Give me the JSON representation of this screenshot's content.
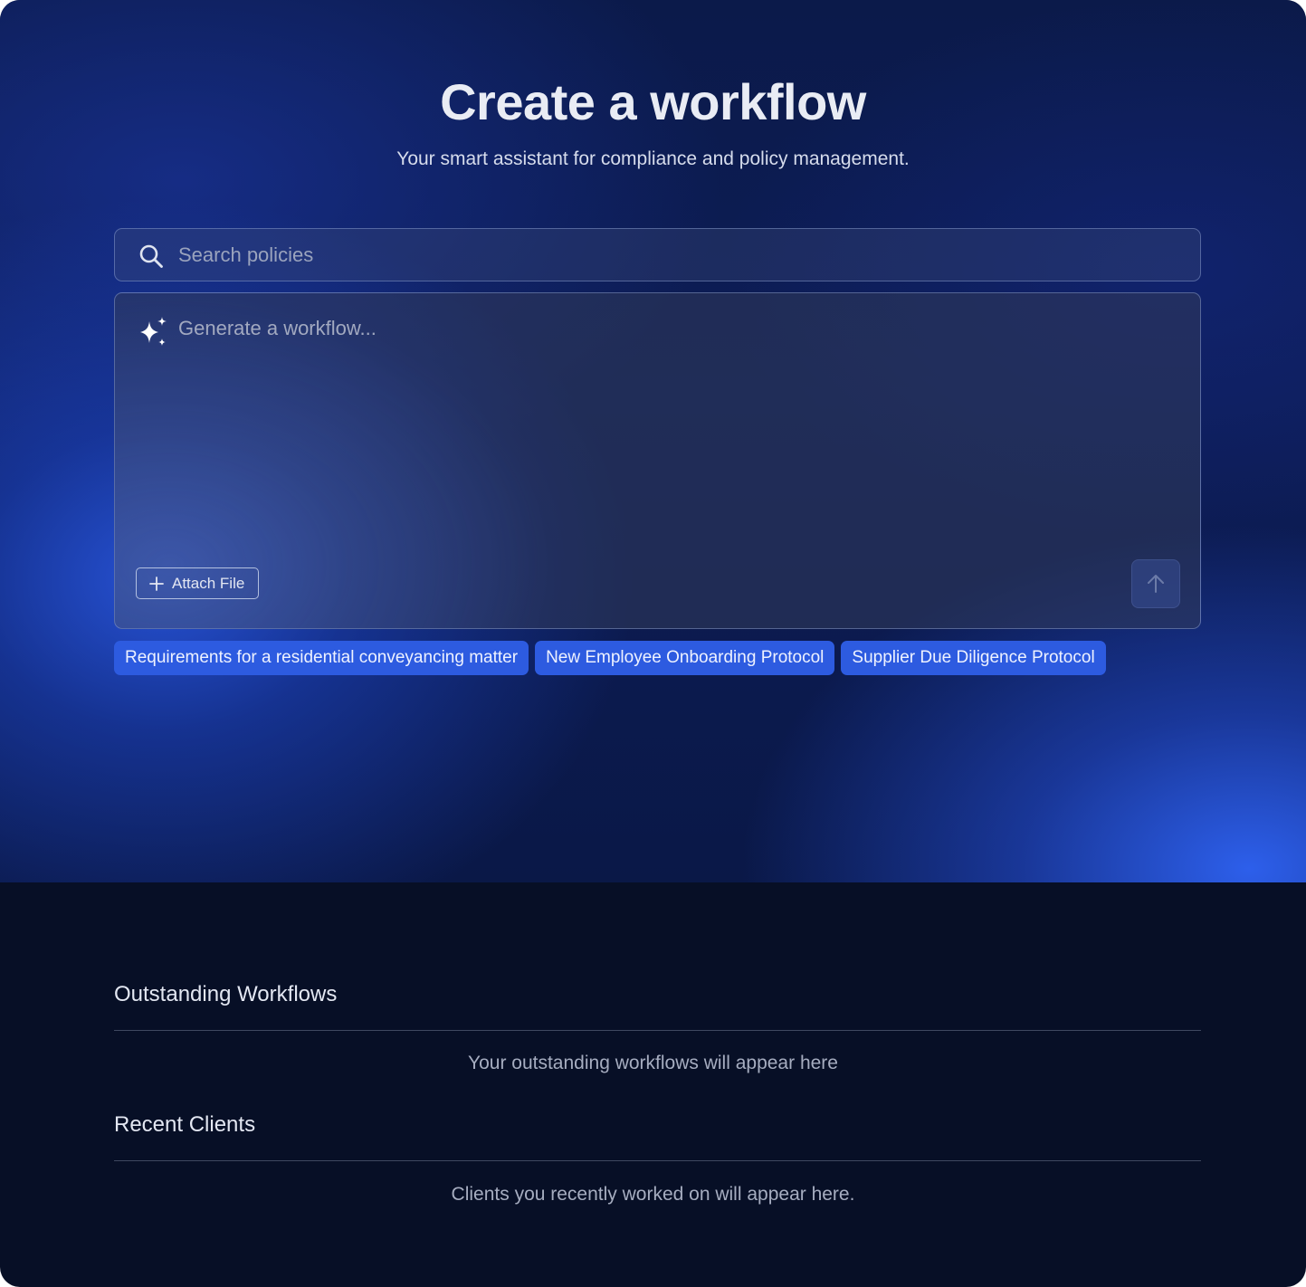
{
  "header": {
    "title": "Create a workflow",
    "subtitle": "Your smart assistant for compliance and policy management."
  },
  "search": {
    "placeholder": "Search policies",
    "icon": "search-icon"
  },
  "composer": {
    "placeholder": "Generate a workflow...",
    "icon": "sparkle-icon",
    "attach_label": "Attach File",
    "send_icon": "arrow-up-icon"
  },
  "suggestions": [
    {
      "label": "Requirements for a residential conveyancing matter"
    },
    {
      "label": "New Employee Onboarding Protocol"
    },
    {
      "label": "Supplier Due Diligence Protocol"
    }
  ],
  "outstanding": {
    "title": "Outstanding Workflows",
    "empty_text": "Your outstanding workflows will appear here"
  },
  "recent_clients": {
    "title": "Recent Clients",
    "empty_text": "Clients you recently worked on will appear here."
  },
  "colors": {
    "accent": "#2d5be0",
    "background": "#070f26",
    "hero_top": "#0b1a4a"
  }
}
